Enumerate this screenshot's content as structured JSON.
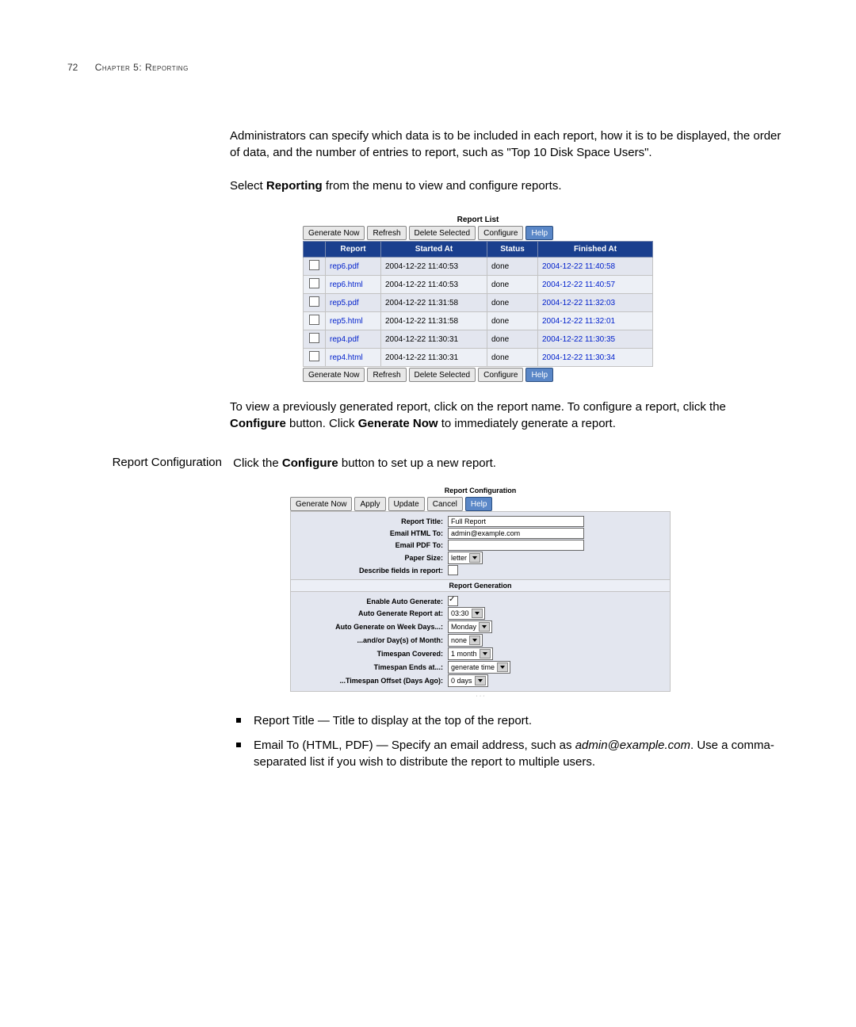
{
  "header": {
    "page_number": "72",
    "chapter_label": "Chapter 5: Reporting"
  },
  "intro_para": "Administrators can specify which data is to be included in each report, how it is to be displayed, the order of data, and the number of entries to report, such as \"Top 10 Disk Space Users\".",
  "select_line_prefix": "Select ",
  "select_line_bold": "Reporting",
  "select_line_suffix": " from the menu to view and configure reports.",
  "report_list": {
    "title": "Report List",
    "buttons": {
      "generate_now": "Generate Now",
      "refresh": "Refresh",
      "delete_selected": "Delete Selected",
      "configure": "Configure",
      "help": "Help"
    },
    "columns": {
      "c1": "",
      "c2": "Report",
      "c3": "Started At",
      "c4": "Status",
      "c5": "Finished At"
    },
    "rows": [
      {
        "report": "rep6.pdf",
        "started": "2004-12-22 11:40:53",
        "status": "done",
        "finished": "2004-12-22 11:40:58"
      },
      {
        "report": "rep6.html",
        "started": "2004-12-22 11:40:53",
        "status": "done",
        "finished": "2004-12-22 11:40:57"
      },
      {
        "report": "rep5.pdf",
        "started": "2004-12-22 11:31:58",
        "status": "done",
        "finished": "2004-12-22 11:32:03"
      },
      {
        "report": "rep5.html",
        "started": "2004-12-22 11:31:58",
        "status": "done",
        "finished": "2004-12-22 11:32:01"
      },
      {
        "report": "rep4.pdf",
        "started": "2004-12-22 11:30:31",
        "status": "done",
        "finished": "2004-12-22 11:30:35"
      },
      {
        "report": "rep4.html",
        "started": "2004-12-22 11:30:31",
        "status": "done",
        "finished": "2004-12-22 11:30:34"
      }
    ]
  },
  "post_table_prefix": "To view a previously generated report, click on the report name. To configure a report, click the ",
  "post_table_bold1": "Configure",
  "post_table_mid": " button. Click ",
  "post_table_bold2": "Generate Now",
  "post_table_suffix": " to immediately generate a report.",
  "section_label": "Report Configuration",
  "section_body_prefix": "Click the ",
  "section_body_bold": "Configure",
  "section_body_suffix": " button to set up a new report.",
  "report_config": {
    "title": "Report Configuration",
    "buttons": {
      "generate_now": "Generate Now",
      "apply": "Apply",
      "update": "Update",
      "cancel": "Cancel",
      "help": "Help"
    },
    "labels": {
      "report_title": "Report Title:",
      "email_html": "Email HTML To:",
      "email_pdf": "Email PDF To:",
      "paper_size": "Paper Size:",
      "describe_fields": "Describe fields in report:",
      "enable_auto": "Enable Auto Generate:",
      "auto_at": "Auto Generate Report at:",
      "auto_weekdays": "Auto Generate on Week Days...:",
      "andor_days": "...and/or Day(s) of Month:",
      "timespan_covered": "Timespan Covered:",
      "timespan_ends": "Timespan Ends at...:",
      "timespan_offset": "...Timespan Offset (Days Ago):"
    },
    "subhead": "Report Generation",
    "values": {
      "report_title": "Full Report",
      "email_html": "admin@example.com",
      "email_pdf": "",
      "paper_size": "letter",
      "describe_fields_checked": false,
      "enable_auto_checked": true,
      "auto_at": "03:30",
      "auto_weekdays": "Monday",
      "andor_days": "none",
      "timespan_covered": "1 month",
      "timespan_ends": "generate time",
      "timespan_offset": "0 days"
    }
  },
  "bullets": {
    "b1_bold": "",
    "b1_text": "Report Title — Title to display at the top of the report.",
    "b2_prefix": "Email To (HTML, PDF) — Specify an email address, such as ",
    "b2_em": "admin@example.com",
    "b2_suffix": ". Use a comma-separated list if you wish to distribute the report to multiple users."
  }
}
